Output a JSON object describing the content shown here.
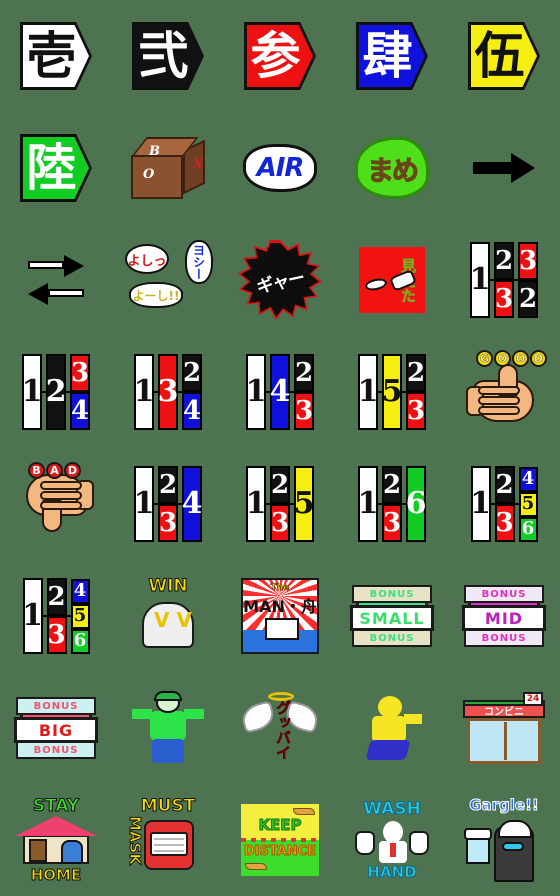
{
  "meta": {
    "background_color": "#4d7350",
    "grid": {
      "columns": 5,
      "rows": 8,
      "cell_size_px": 112
    },
    "title": "Emoji sticker set preview"
  },
  "palette": {
    "white": "#ffffff",
    "black": "#111111",
    "red": "#ee1111",
    "blue": "#1111dd",
    "yellow": "#f5ee10",
    "green": "#11cc22",
    "skin": "#f3b780",
    "brown": "#8a5330",
    "gold": "#f0c83c",
    "cyan": "#28c8e8",
    "magenta": "#e030c0"
  },
  "items": [
    {
      "id": "kanji-ichi",
      "name": "pentagon-kanji-1",
      "kind": "pentagon-kanji",
      "text": "壱",
      "bg": "#ffffff",
      "fg": "#111111",
      "border": "#111111"
    },
    {
      "id": "kanji-ni",
      "name": "pentagon-kanji-2",
      "kind": "pentagon-kanji",
      "text": "弐",
      "bg": "#111111",
      "fg": "#ffffff",
      "border": "#111111"
    },
    {
      "id": "kanji-san",
      "name": "pentagon-kanji-3",
      "kind": "pentagon-kanji",
      "text": "参",
      "bg": "#ee1111",
      "fg": "#ffffff",
      "border": "#111111"
    },
    {
      "id": "kanji-shi",
      "name": "pentagon-kanji-4",
      "kind": "pentagon-kanji",
      "text": "肆",
      "bg": "#1111dd",
      "fg": "#ffffff",
      "border": "#111111"
    },
    {
      "id": "kanji-go",
      "name": "pentagon-kanji-5",
      "kind": "pentagon-kanji",
      "text": "伍",
      "bg": "#f5ee10",
      "fg": "#111111",
      "border": "#111111"
    },
    {
      "id": "kanji-roku",
      "name": "pentagon-kanji-6",
      "kind": "pentagon-kanji",
      "text": "陸",
      "bg": "#11cc22",
      "fg": "#ffffff",
      "border": "#111111"
    },
    {
      "id": "box",
      "name": "cardboard-box",
      "kind": "box",
      "labels": {
        "b": "B",
        "o": "O",
        "x": "X"
      }
    },
    {
      "id": "air",
      "name": "air-cloud-badge",
      "kind": "cloud",
      "text": "AIR",
      "fg": "#1427d6"
    },
    {
      "id": "mame",
      "name": "green-bean-mame",
      "kind": "bean",
      "text": "まめ",
      "fg": "#8a5a25"
    },
    {
      "id": "arrow-right",
      "name": "right-arrow",
      "kind": "arrow-right"
    },
    {
      "id": "arrows-both",
      "name": "two-way-arrows",
      "kind": "arrows-two"
    },
    {
      "id": "yoshi",
      "name": "speech-bubbles-yoshi",
      "kind": "bubbles",
      "bubbles": [
        {
          "text": "よしっ",
          "color": "#d21a1a"
        },
        {
          "text": "ヨシー",
          "color": "#1030cf"
        },
        {
          "text": "よーし!!",
          "color": "#c9b325"
        }
      ]
    },
    {
      "id": "gyaa",
      "name": "starburst-gyaa",
      "kind": "burst",
      "text": "ギャー",
      "fg": "#ffffff"
    },
    {
      "id": "mieta",
      "name": "red-square-mieta",
      "kind": "redsq",
      "text": "見えた",
      "fg": "#f0c83c"
    },
    {
      "id": "combo-1-23-32",
      "name": "number-combo",
      "kind": "combo",
      "lead": {
        "value": "1",
        "bg": "#ffffff",
        "fg": "#111111"
      },
      "pairs": [
        {
          "top": {
            "value": "2",
            "bg": "#111111",
            "fg": "#ffffff"
          },
          "bottom": {
            "value": "3",
            "bg": "#ee1111",
            "fg": "#ffffff"
          }
        },
        {
          "top": {
            "value": "3",
            "bg": "#ee1111",
            "fg": "#ffffff"
          },
          "bottom": {
            "value": "2",
            "bg": "#111111",
            "fg": "#ffffff"
          }
        }
      ]
    },
    {
      "id": "combo-1-2-34",
      "name": "number-combo",
      "kind": "combo",
      "lead": {
        "value": "1",
        "bg": "#ffffff",
        "fg": "#111111"
      },
      "mid": {
        "value": "2",
        "bg": "#111111",
        "fg": "#ffffff"
      },
      "stack": [
        {
          "value": "3",
          "bg": "#ee1111",
          "fg": "#ffffff"
        },
        {
          "value": "4",
          "bg": "#1111dd",
          "fg": "#ffffff"
        }
      ]
    },
    {
      "id": "combo-1-3-24",
      "name": "number-combo",
      "kind": "combo",
      "lead": {
        "value": "1",
        "bg": "#ffffff",
        "fg": "#111111"
      },
      "mid": {
        "value": "3",
        "bg": "#ee1111",
        "fg": "#ffffff"
      },
      "stack": [
        {
          "value": "2",
          "bg": "#111111",
          "fg": "#ffffff"
        },
        {
          "value": "4",
          "bg": "#1111dd",
          "fg": "#ffffff"
        }
      ]
    },
    {
      "id": "combo-1-4-23",
      "name": "number-combo",
      "kind": "combo",
      "lead": {
        "value": "1",
        "bg": "#ffffff",
        "fg": "#111111"
      },
      "mid": {
        "value": "4",
        "bg": "#1111dd",
        "fg": "#ffffff"
      },
      "stack": [
        {
          "value": "2",
          "bg": "#111111",
          "fg": "#ffffff"
        },
        {
          "value": "3",
          "bg": "#ee1111",
          "fg": "#ffffff"
        }
      ]
    },
    {
      "id": "combo-1-5-23",
      "name": "number-combo",
      "kind": "combo",
      "lead": {
        "value": "1",
        "bg": "#ffffff",
        "fg": "#111111"
      },
      "mid": {
        "value": "5",
        "bg": "#f5ee10",
        "fg": "#111111"
      },
      "stack": [
        {
          "value": "2",
          "bg": "#111111",
          "fg": "#ffffff"
        },
        {
          "value": "3",
          "bg": "#ee1111",
          "fg": "#ffffff"
        }
      ]
    },
    {
      "id": "good",
      "name": "thumbs-up-good",
      "kind": "thumb-up",
      "text": "GOOD"
    },
    {
      "id": "bad",
      "name": "thumbs-down-bad",
      "kind": "thumb-down",
      "text": "BAD"
    },
    {
      "id": "combo-1-23-4",
      "name": "number-combo",
      "kind": "combo",
      "lead": {
        "value": "1",
        "bg": "#ffffff",
        "fg": "#111111"
      },
      "stack": [
        {
          "value": "2",
          "bg": "#111111",
          "fg": "#ffffff"
        },
        {
          "value": "3",
          "bg": "#ee1111",
          "fg": "#ffffff"
        }
      ],
      "tail": {
        "value": "4",
        "bg": "#1111dd",
        "fg": "#ffffff"
      }
    },
    {
      "id": "combo-1-23-5",
      "name": "number-combo",
      "kind": "combo",
      "lead": {
        "value": "1",
        "bg": "#ffffff",
        "fg": "#111111"
      },
      "stack": [
        {
          "value": "2",
          "bg": "#111111",
          "fg": "#ffffff"
        },
        {
          "value": "3",
          "bg": "#ee1111",
          "fg": "#ffffff"
        }
      ],
      "tail": {
        "value": "5",
        "bg": "#f5ee10",
        "fg": "#111111"
      }
    },
    {
      "id": "combo-1-23-6",
      "name": "number-combo",
      "kind": "combo",
      "lead": {
        "value": "1",
        "bg": "#ffffff",
        "fg": "#111111"
      },
      "stack": [
        {
          "value": "2",
          "bg": "#111111",
          "fg": "#ffffff"
        },
        {
          "value": "3",
          "bg": "#ee1111",
          "fg": "#ffffff"
        }
      ],
      "tail": {
        "value": "6",
        "bg": "#11cc22",
        "fg": "#ffffff"
      }
    },
    {
      "id": "combo-1-23-456",
      "name": "number-combo",
      "kind": "combo",
      "lead": {
        "value": "1",
        "bg": "#ffffff",
        "fg": "#111111"
      },
      "stack": [
        {
          "value": "2",
          "bg": "#111111",
          "fg": "#ffffff"
        },
        {
          "value": "3",
          "bg": "#ee1111",
          "fg": "#ffffff"
        }
      ],
      "triple": [
        {
          "value": "4",
          "bg": "#1111dd",
          "fg": "#ffffff"
        },
        {
          "value": "5",
          "bg": "#f5ee10",
          "fg": "#111111"
        },
        {
          "value": "6",
          "bg": "#11cc22",
          "fg": "#ffffff"
        }
      ]
    },
    {
      "id": "combo-1-456-23",
      "name": "number-combo",
      "kind": "combo",
      "lead": {
        "value": "1",
        "bg": "#ffffff",
        "fg": "#111111"
      },
      "triple": [
        {
          "value": "4",
          "bg": "#1111dd",
          "fg": "#ffffff"
        },
        {
          "value": "5",
          "bg": "#f5ee10",
          "fg": "#111111"
        },
        {
          "value": "6",
          "bg": "#11cc22",
          "fg": "#ffffff"
        }
      ],
      "stack": [
        {
          "value": "2",
          "bg": "#111111",
          "fg": "#ffffff"
        },
        {
          "value": "3",
          "bg": "#ee1111",
          "fg": "#ffffff"
        }
      ]
    },
    {
      "id": "win",
      "name": "win-figure",
      "kind": "win",
      "text": "WIN"
    },
    {
      "id": "the-man",
      "name": "the-man-boat-card",
      "kind": "card",
      "title_small": "The",
      "title_big": "MAN・舟"
    },
    {
      "id": "small-bonus",
      "name": "small-bonus-badge",
      "kind": "badge",
      "top": "BONUS",
      "main": "SMALL",
      "bottom": "BONUS",
      "accent": "#3adf8a",
      "main_color": "#3adf6a",
      "strip_bg": "#e8e2c4"
    },
    {
      "id": "mid-bonus",
      "name": "mid-bonus-badge",
      "kind": "badge",
      "top": "BONUS",
      "main": "MID",
      "bottom": "BONUS",
      "accent": "#e030c0",
      "main_color": "#bb22bb",
      "strip_bg": "#f0e8f4"
    },
    {
      "id": "big-bonus",
      "name": "big-bonus-badge",
      "kind": "badge",
      "top": "BONUS",
      "main": "BIG",
      "bottom": "BONUS",
      "accent": "#f4526a",
      "main_color": "#e01b1b",
      "strip_bg": "#cdf0f2"
    },
    {
      "id": "green-man",
      "name": "green-racer-figure",
      "kind": "greenman"
    },
    {
      "id": "goodbye",
      "name": "angel-wings-goodbye",
      "kind": "wings",
      "text": "グッバイ"
    },
    {
      "id": "runner",
      "name": "running-figure",
      "kind": "runner"
    },
    {
      "id": "konbini",
      "name": "convenience-store",
      "kind": "shop",
      "sign": "コンビニ",
      "tag": "24"
    },
    {
      "id": "stay-home",
      "name": "stay-home-sticker",
      "kind": "stayhome",
      "top": "STAY",
      "bottom": "HOME"
    },
    {
      "id": "must-mask",
      "name": "must-mask-sticker",
      "kind": "mustmask",
      "word1": "MUST",
      "word2": "MASK"
    },
    {
      "id": "keep-distance",
      "name": "keep-distance-sticker",
      "kind": "keep",
      "top": "KEEP",
      "bottom": "DISTANCE"
    },
    {
      "id": "wash-hand",
      "name": "wash-hand-sticker",
      "kind": "wash",
      "top": "WASH",
      "bottom": "HAND"
    },
    {
      "id": "gargle",
      "name": "gargle-sticker",
      "kind": "gargle",
      "text": "Gargle!!"
    }
  ]
}
